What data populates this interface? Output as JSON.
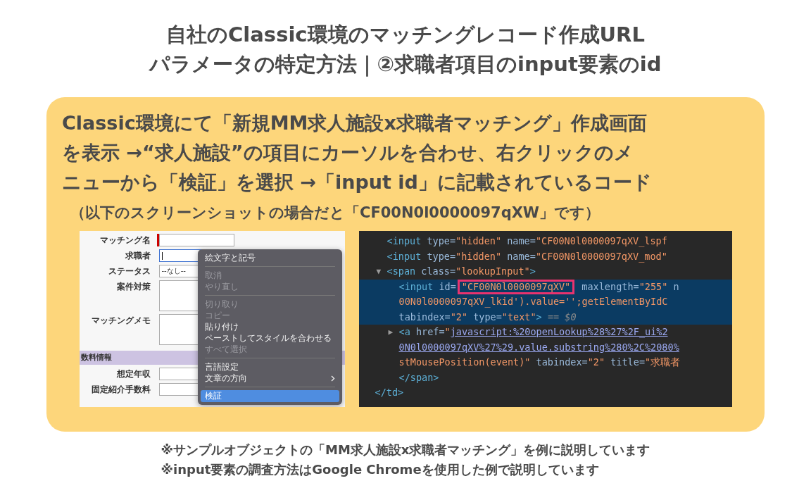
{
  "title": [
    "自社のClassic環境のマッチングレコード作成URL",
    "パラメータの特定方法｜②求職者項目のinput要素のid"
  ],
  "instruction": [
    "Classic環境にて「新規MM求人施設x求職者マッチング」作成画面",
    "を表示 →“求人施設”の項目にカーソルを合わせ、右クリックのメ",
    "ニューから「検証」を選択 →「input id」に記載されているコード"
  ],
  "note": "（以下のスクリーンショットの場合だと「CF00N0l0000097qXW」です）",
  "form": {
    "fields": [
      {
        "label": "マッチング名",
        "kind": "text",
        "required": true,
        "focused": false
      },
      {
        "label": "求職者",
        "kind": "text",
        "required": false,
        "focused": true
      },
      {
        "label": "ステータス",
        "kind": "select",
        "value": "--なし--",
        "required": false,
        "focused": false
      },
      {
        "label": "案件対策",
        "kind": "textarea",
        "required": false,
        "focused": false
      },
      {
        "label": "マッチングメモ",
        "kind": "textarea",
        "required": false,
        "focused": false
      }
    ],
    "section": "数料情報",
    "fields2": [
      {
        "label": "想定年収",
        "kind": "text",
        "required": false,
        "focused": false
      },
      {
        "label": "固定紹介手数料",
        "kind": "text",
        "required": false,
        "focused": false
      }
    ]
  },
  "menu": [
    [
      {
        "label": "絵文字と記号",
        "disabled": false,
        "selected": false,
        "submenu": false
      }
    ],
    [
      {
        "label": "取消",
        "disabled": true,
        "selected": false,
        "submenu": false
      },
      {
        "label": "やり直し",
        "disabled": true,
        "selected": false,
        "submenu": false
      }
    ],
    [
      {
        "label": "切り取り",
        "disabled": true,
        "selected": false,
        "submenu": false
      },
      {
        "label": "コピー",
        "disabled": true,
        "selected": false,
        "submenu": false
      },
      {
        "label": "貼り付け",
        "disabled": false,
        "selected": false,
        "submenu": false
      },
      {
        "label": "ペーストしてスタイルを合わせる",
        "disabled": false,
        "selected": false,
        "submenu": false
      },
      {
        "label": "すべて選択",
        "disabled": true,
        "selected": false,
        "submenu": false
      }
    ],
    [
      {
        "label": "言語設定",
        "disabled": false,
        "selected": false,
        "submenu": false
      },
      {
        "label": "文章の方向",
        "disabled": false,
        "selected": false,
        "submenu": true
      }
    ],
    [
      {
        "label": "検証",
        "disabled": false,
        "selected": true,
        "submenu": false
      }
    ]
  ],
  "devtools": [
    {
      "children": [
        {
          "selected": false,
          "lines": [
            [
              {
                "kind": "tag",
                "text": "<input"
              },
              {
                "kind": "attr",
                "text": " type="
              },
              {
                "kind": "value",
                "text": "\"hidden\""
              },
              {
                "kind": "attr",
                "text": " name="
              },
              {
                "kind": "value",
                "text": "\"CF00N0l0000097qXV_lspf"
              }
            ]
          ]
        },
        {
          "selected": false,
          "lines": [
            [
              {
                "kind": "tag",
                "text": "<input"
              },
              {
                "kind": "attr",
                "text": " type="
              },
              {
                "kind": "value",
                "text": "\"hidden\""
              },
              {
                "kind": "attr",
                "text": " name="
              },
              {
                "kind": "value",
                "text": "\"CF00N0l0000097qXV_mod\""
              }
            ]
          ]
        },
        {
          "selected": false,
          "expander": "▼",
          "lines": [
            [
              {
                "kind": "tag",
                "text": "<span"
              },
              {
                "kind": "attr",
                "text": " class="
              },
              {
                "kind": "value",
                "text": "\"lookupInput\""
              },
              {
                "kind": "tag",
                "text": ">"
              }
            ]
          ],
          "children": [
            {
              "selected": true,
              "lines": [
                [
                  {
                    "kind": "tag",
                    "text": "<input"
                  },
                  {
                    "kind": "attr",
                    "text": " id="
                  },
                  {
                    "kind": "boxed",
                    "text": "\"CF00N0l0000097qXV\""
                  },
                  {
                    "kind": "attr",
                    "text": " maxlength="
                  },
                  {
                    "kind": "value",
                    "text": "\"255\""
                  },
                  {
                    "kind": "attr",
                    "text": " n"
                  }
                ],
                [
                  {
                    "kind": "value",
                    "text": "00N0l0000097qXV_lkid').value='';getElementByIdC"
                  }
                ],
                [
                  {
                    "kind": "attr",
                    "text": "tabindex="
                  },
                  {
                    "kind": "value",
                    "text": "\"2\""
                  },
                  {
                    "kind": "attr",
                    "text": " type="
                  },
                  {
                    "kind": "value",
                    "text": "\"text\""
                  },
                  {
                    "kind": "tag",
                    "text": ">"
                  },
                  {
                    "kind": "ref",
                    "text": " == $0"
                  }
                ]
              ]
            },
            {
              "selected": false,
              "expander": "▶",
              "lines": [
                [
                  {
                    "kind": "tag",
                    "text": "<a"
                  },
                  {
                    "kind": "attr",
                    "text": " href="
                  },
                  {
                    "kind": "value",
                    "text": "\""
                  },
                  {
                    "kind": "link",
                    "text": "javascript:%20openLookup%28%27%2F_ui%2"
                  }
                ],
                [
                  {
                    "kind": "link",
                    "text": "0N0l0000097qXV%27%29.value.substring%280%2C%2080%"
                  }
                ],
                [
                  {
                    "kind": "value",
                    "text": "stMousePosition(event)\""
                  },
                  {
                    "kind": "attr",
                    "text": " tabindex="
                  },
                  {
                    "kind": "value",
                    "text": "\"2\""
                  },
                  {
                    "kind": "attr",
                    "text": " title="
                  },
                  {
                    "kind": "value",
                    "text": "\"求職者"
                  }
                ]
              ]
            },
            {
              "selected": false,
              "lines": [
                [
                  {
                    "kind": "tag",
                    "text": "</span>"
                  }
                ]
              ]
            }
          ]
        }
      ]
    },
    {
      "selected": false,
      "lines": [
        [
          {
            "kind": "tag",
            "text": "</td>"
          }
        ]
      ]
    }
  ],
  "footnotes": [
    "※サンプルオブジェクトの「MM求人施設x求職者マッチング」を例に説明しています",
    "※input要素の調査方法はGoogle Chromeを使用した例で説明しています"
  ]
}
